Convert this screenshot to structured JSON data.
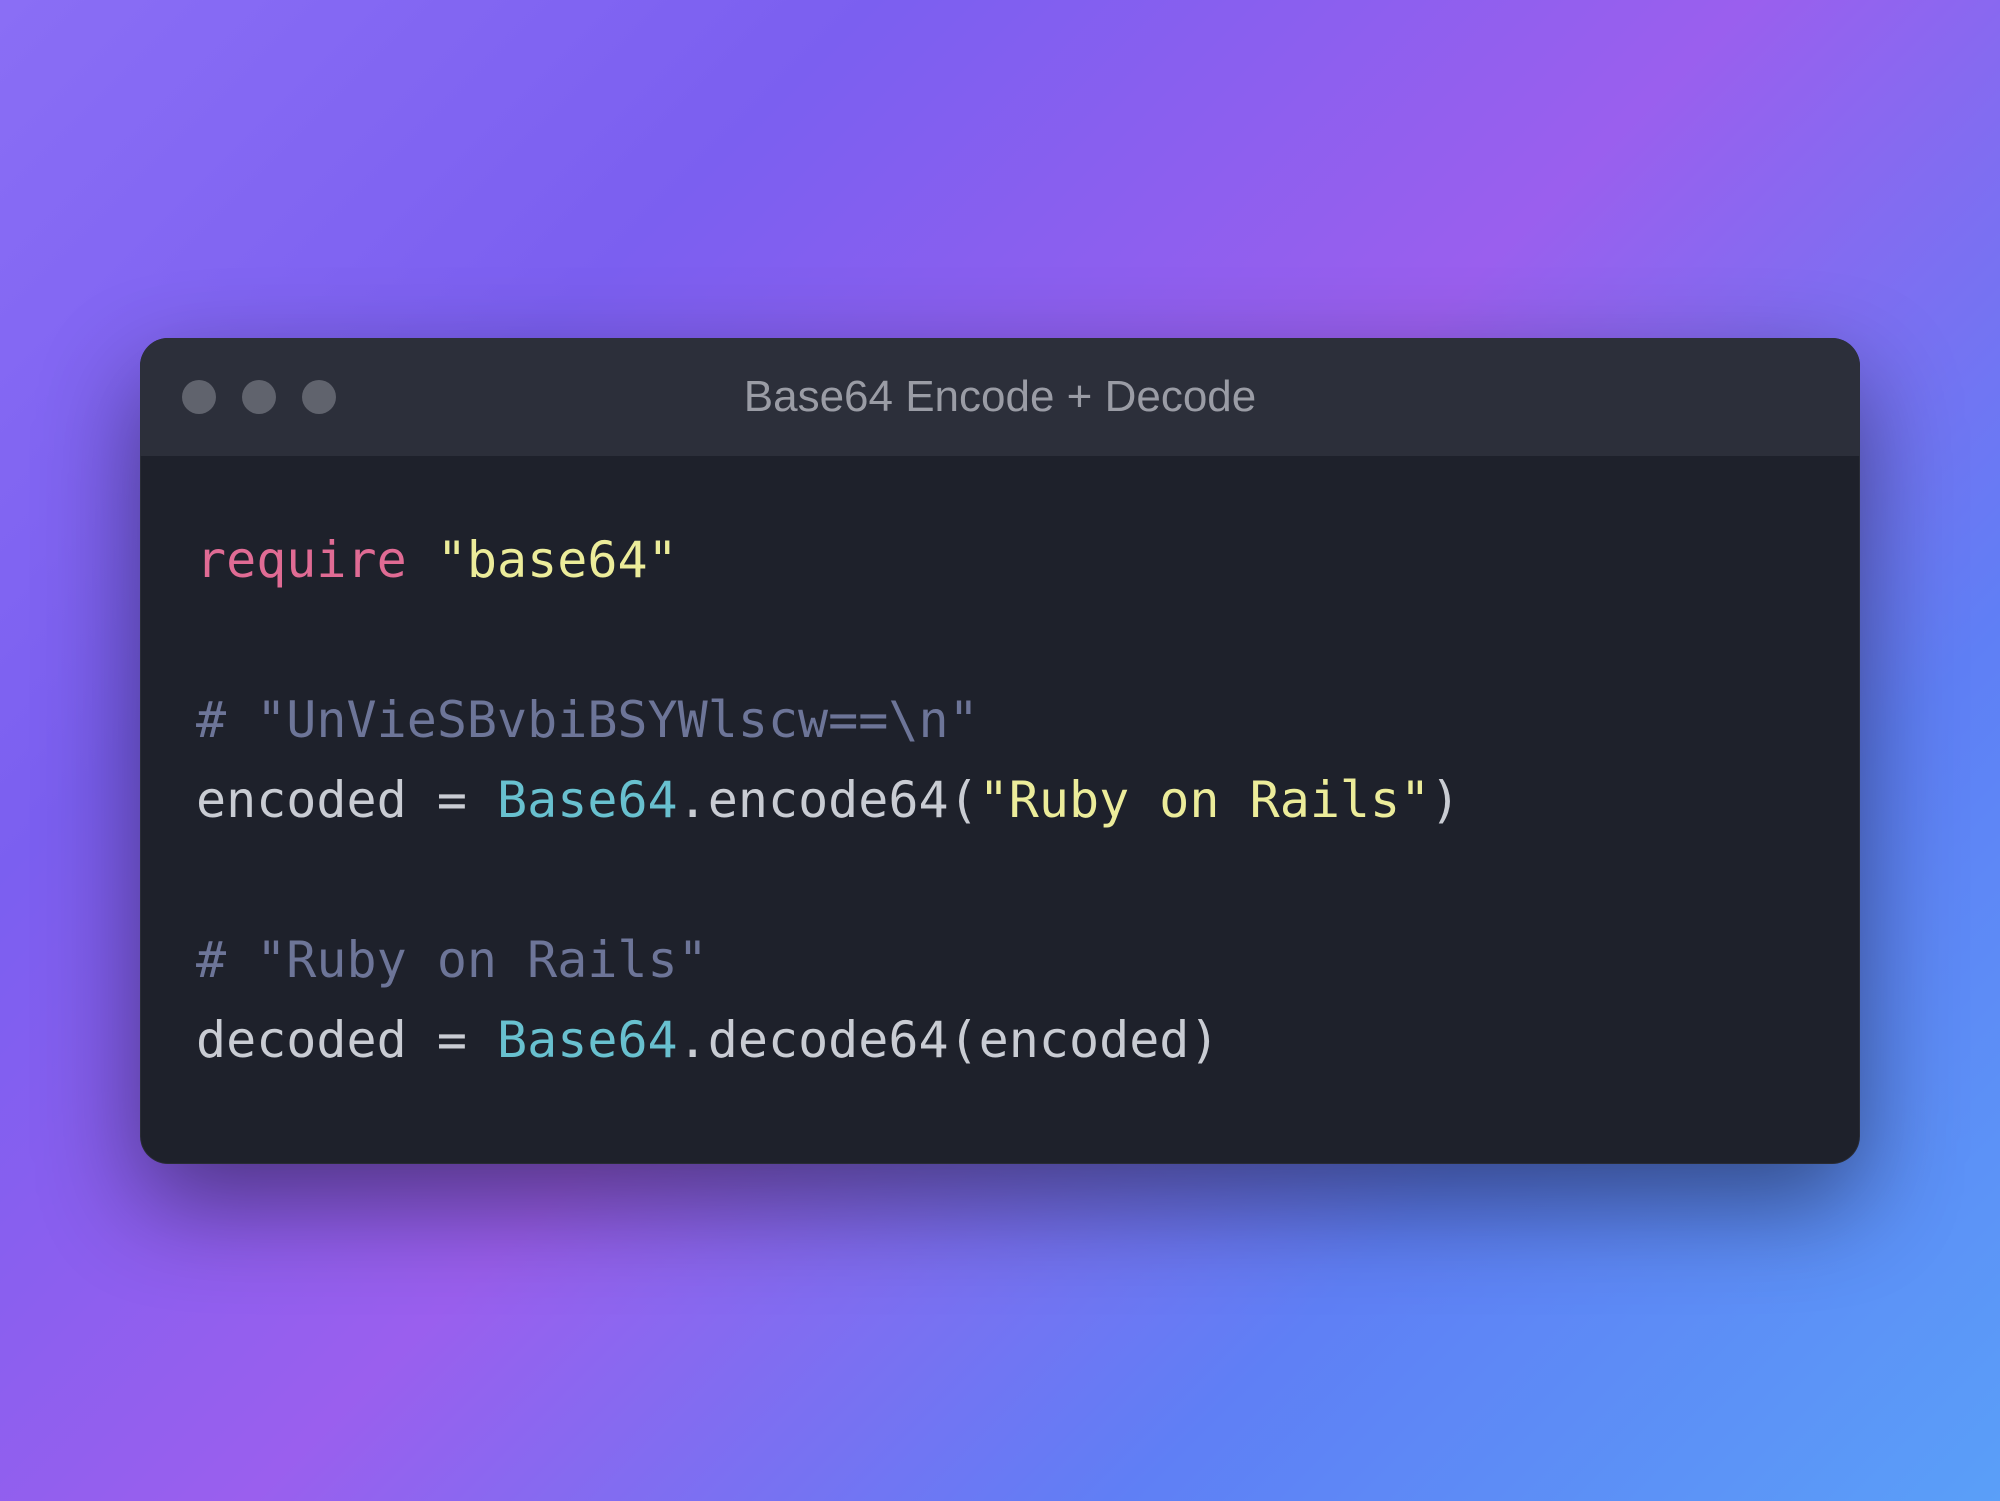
{
  "window": {
    "title": "Base64 Encode + Decode"
  },
  "code": {
    "lines": [
      {
        "id": "l1",
        "segments": [
          {
            "cls": "tok-keyword",
            "text": "require"
          },
          {
            "cls": "tok-plain",
            "text": " "
          },
          {
            "cls": "tok-string",
            "text": "\"base64\""
          }
        ]
      },
      {
        "id": "l2",
        "segments": [
          {
            "cls": "tok-plain",
            "text": ""
          }
        ]
      },
      {
        "id": "l3",
        "segments": [
          {
            "cls": "tok-comment",
            "text": "# \"UnVieSBvbiBSYWlscw==\\n\""
          }
        ]
      },
      {
        "id": "l4",
        "segments": [
          {
            "cls": "tok-plain",
            "text": "encoded = "
          },
          {
            "cls": "tok-const",
            "text": "Base64"
          },
          {
            "cls": "tok-plain",
            "text": ".encode64("
          },
          {
            "cls": "tok-string",
            "text": "\"Ruby on Rails\""
          },
          {
            "cls": "tok-plain",
            "text": ")"
          }
        ]
      },
      {
        "id": "l5",
        "segments": [
          {
            "cls": "tok-plain",
            "text": ""
          }
        ]
      },
      {
        "id": "l6",
        "segments": [
          {
            "cls": "tok-comment",
            "text": "# \"Ruby on Rails\""
          }
        ]
      },
      {
        "id": "l7",
        "segments": [
          {
            "cls": "tok-plain",
            "text": "decoded = "
          },
          {
            "cls": "tok-const",
            "text": "Base64"
          },
          {
            "cls": "tok-plain",
            "text": ".decode64(encoded)"
          }
        ]
      }
    ]
  }
}
